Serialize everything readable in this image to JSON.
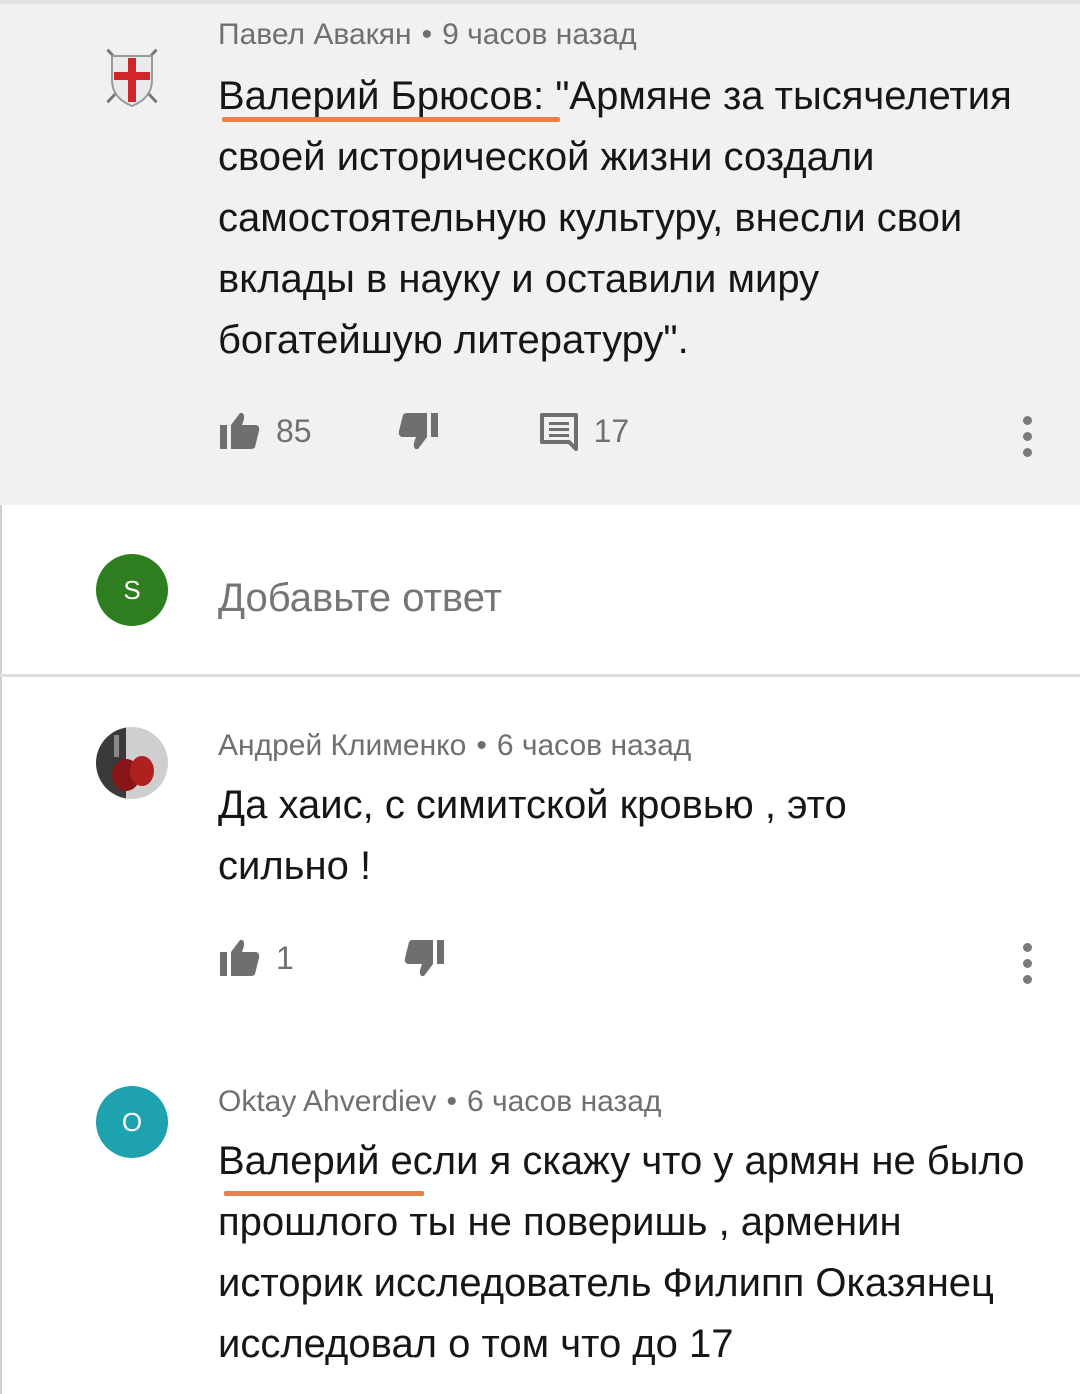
{
  "comments": [
    {
      "author": "Павел Авакян",
      "time": "9 часов назад",
      "text": "Валерий Брюсов: \"Армяне за тысячелетия своей исторической жизни создали самостоятельную культуру, внесли свои вклады в науку и оставили миру богатейшую литературу\".",
      "likes": "85",
      "replies": "17"
    },
    {
      "author": "Андрей Клименко",
      "time": "6 часов назад",
      "text": "Да хаис, с симитской кровью , это сильно !",
      "likes": "1"
    },
    {
      "author": "Oktay Ahverdiev",
      "time": "6 часов назад",
      "avatar_letter": "O",
      "text": "Валерий если я скажу что у армян не было прошлого ты не поверишь , арменин историк исследователь Филипп Оказянец исследовал о том что до 17"
    }
  ],
  "reply_box": {
    "avatar_letter": "S",
    "placeholder": "Добавьте ответ"
  },
  "colors": {
    "highlight_bg": "#f1f1f1",
    "underline": "#e8804a",
    "avatar_s": "#2e7d1f",
    "avatar_o": "#1ea2ad"
  },
  "icons": {
    "like": "thumb-up-icon",
    "dislike": "thumb-down-icon",
    "reply": "comment-icon",
    "more": "more-vert-icon"
  }
}
